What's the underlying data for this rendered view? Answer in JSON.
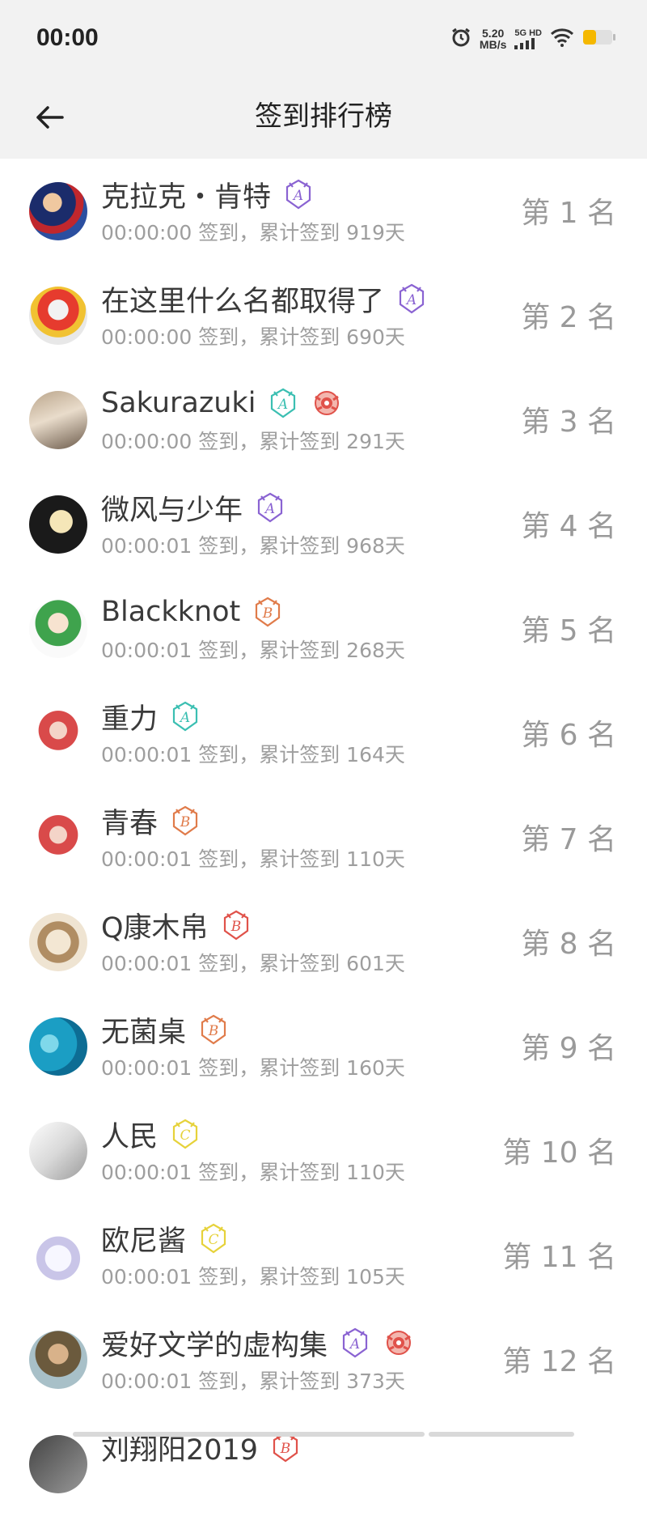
{
  "status_bar": {
    "time": "00:00",
    "net_speed_value": "5.20",
    "net_speed_unit": "MB/s",
    "signal_label": "5G HD",
    "battery_color": "#f5b800"
  },
  "header": {
    "title": "签到排行榜"
  },
  "colors": {
    "badge_purple": "#8a63d2",
    "badge_teal": "#3bbfb2",
    "badge_orange": "#e07b4a",
    "badge_red": "#e0524a",
    "badge_yellow": "#e6d23a"
  },
  "rows": [
    {
      "name": "克拉克・肯特",
      "sub": "00:00:00 签到，累计签到 919天",
      "rank": "第 1 名",
      "badges": [
        "purple-A"
      ]
    },
    {
      "name": "在这里什么名都取得了",
      "sub": "00:00:00 签到，累计签到 690天",
      "rank": "第 2 名",
      "badges": [
        "purple-A"
      ]
    },
    {
      "name": "Sakurazuki",
      "sub": "00:00:00 签到，累计签到 291天",
      "rank": "第 3 名",
      "badges": [
        "teal-A",
        "red-medal"
      ]
    },
    {
      "name": "微风与少年",
      "sub": "00:00:01 签到，累计签到 968天",
      "rank": "第 4 名",
      "badges": [
        "purple-A"
      ]
    },
    {
      "name": "Blackknot",
      "sub": "00:00:01 签到，累计签到 268天",
      "rank": "第 5 名",
      "badges": [
        "orange-B"
      ]
    },
    {
      "name": "重力",
      "sub": "00:00:01 签到，累计签到 164天",
      "rank": "第 6 名",
      "badges": [
        "teal-A"
      ]
    },
    {
      "name": "青春",
      "sub": "00:00:01 签到，累计签到 110天",
      "rank": "第 7 名",
      "badges": [
        "orange-B"
      ]
    },
    {
      "name": "Q康木帛",
      "sub": "00:00:01 签到，累计签到 601天",
      "rank": "第 8 名",
      "badges": [
        "red-B"
      ]
    },
    {
      "name": "无菌桌",
      "sub": "00:00:01 签到，累计签到 160天",
      "rank": "第 9 名",
      "badges": [
        "orange-B"
      ]
    },
    {
      "name": "人民",
      "sub": "00:00:01 签到，累计签到 110天",
      "rank": "第 10 名",
      "badges": [
        "yellow-C"
      ]
    },
    {
      "name": "欧尼酱",
      "sub": "00:00:01 签到，累计签到 105天",
      "rank": "第 11 名",
      "badges": [
        "yellow-C"
      ]
    },
    {
      "name": "爱好文学的虚构集",
      "sub": "00:00:01 签到，累计签到 373天",
      "rank": "第 12 名",
      "badges": [
        "purple-A",
        "red-medal"
      ]
    },
    {
      "name": "刘翔阳2019",
      "sub": "",
      "rank": "",
      "badges": [
        "red-B"
      ]
    }
  ]
}
